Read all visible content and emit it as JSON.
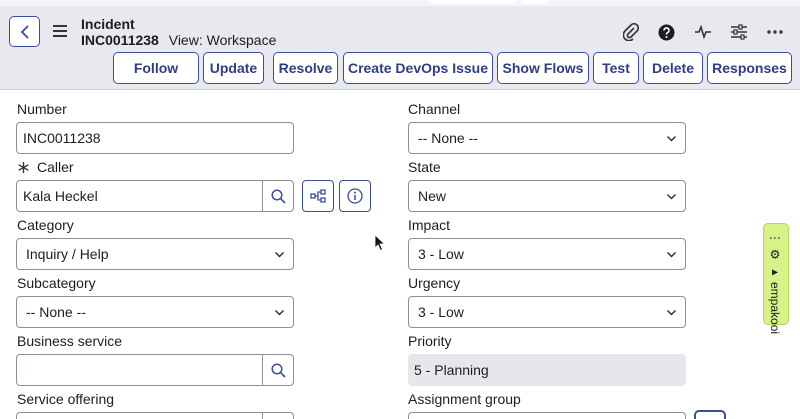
{
  "header": {
    "record_type": "Incident",
    "record_number": "INC0011238",
    "view_label": "View: Workspace"
  },
  "toolbar": {
    "buttons": [
      {
        "label": "Follow"
      },
      {
        "label": "Update"
      },
      {
        "label": "Resolve"
      },
      {
        "label": "Create DevOps Issue"
      },
      {
        "label": "Show Flows"
      },
      {
        "label": "Test"
      },
      {
        "label": "Delete"
      },
      {
        "label": "Responses"
      }
    ]
  },
  "form": {
    "number": {
      "label": "Number",
      "value": "INC0011238"
    },
    "caller": {
      "label": "Caller",
      "value": "Kala Heckel"
    },
    "category": {
      "label": "Category",
      "value": "Inquiry / Help"
    },
    "subcategory": {
      "label": "Subcategory",
      "value": "-- None --"
    },
    "business_service": {
      "label": "Business service",
      "value": ""
    },
    "service_offering": {
      "label": "Service offering"
    },
    "channel": {
      "label": "Channel",
      "value": "-- None --"
    },
    "state": {
      "label": "State",
      "value": "New"
    },
    "impact": {
      "label": "Impact",
      "value": "3 - Low"
    },
    "urgency": {
      "label": "Urgency",
      "value": "3 - Low"
    },
    "priority": {
      "label": "Priority",
      "value": "5 - Planning"
    },
    "assignment_group": {
      "label": "Assignment group"
    }
  },
  "side_tab": {
    "label": "⋮ ⚙ ▸ empakooi"
  },
  "colors": {
    "accent": "#3c4d9c",
    "header_bg": "#e7e9ee",
    "side_tab": "#d8f28a"
  }
}
